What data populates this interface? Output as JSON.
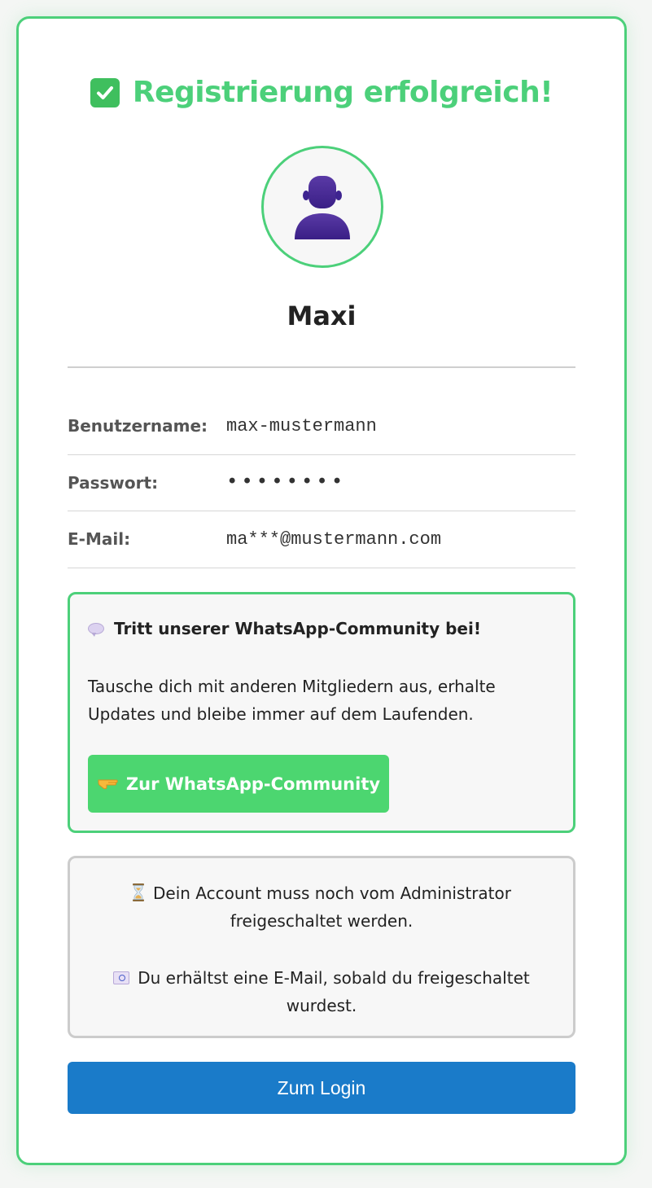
{
  "header": {
    "check_icon": "check-mark-button-icon",
    "title": "Registrierung erfolgreich!",
    "accent_color": "#4cd07a"
  },
  "profile": {
    "avatar_icon": "user-silhouette-icon",
    "display_name": "Maxi"
  },
  "details": {
    "rows": [
      {
        "label": "Benutzername:",
        "value": "max-mustermann"
      },
      {
        "label": "Passwort:",
        "value": "••••••••"
      },
      {
        "label": "E-Mail:",
        "value": "ma***@mustermann.com"
      }
    ]
  },
  "community": {
    "icon": "speech-bubble-icon",
    "heading": "Tritt unserer WhatsApp-Community bei!",
    "text": "Tausche dich mit anderen Mitgliedern aus, erhalte Updates und bleibe immer auf dem Laufenden.",
    "button_icon": "pointing-hand-icon",
    "button_label": "Zur WhatsApp-Community",
    "button_color": "#4cd670"
  },
  "notice": {
    "line1_icon": "hourglass-icon",
    "line1": "Dein Account muss noch vom Administrator freigeschaltet werden.",
    "line2_icon": "email-icon",
    "line2": "Du erhältst eine E-Mail, sobald du freigeschaltet wurdest."
  },
  "actions": {
    "login_label": "Zum Login",
    "login_color": "#1a7bc9"
  }
}
